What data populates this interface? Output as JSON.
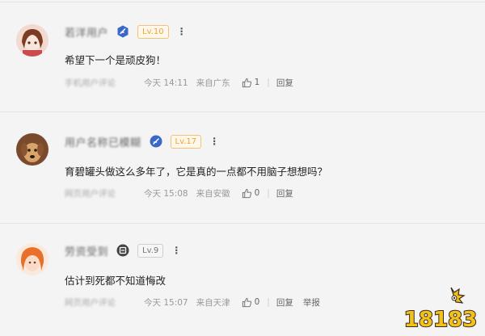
{
  "comments": [
    {
      "username": "若洋用户",
      "level": "Lv.10",
      "level_color": "#f0a533",
      "text": "希望下一个是顽皮狗！",
      "source": "手机用户评论",
      "time": "今天 14:11",
      "location": "来自广东",
      "likes": "1",
      "reply": "回复",
      "verify_color": "#3a67c9"
    },
    {
      "username": "用户名称已模糊",
      "level": "Lv.17",
      "level_color": "#f0a533",
      "text": "育碧罐头做这么多年了，它是真的一点都不用脑子想想吗？",
      "source": "网页用户评论",
      "time": "今天 15:08",
      "location": "来自安徽",
      "likes": "0",
      "reply": "回复",
      "verify_color": "#3a67c9"
    },
    {
      "username": "劳资受到",
      "level": "Lv.9",
      "level_color": "#8c8c8c",
      "text": "估计到死都不知道悔改",
      "source": "网页用户评论",
      "time": "今天 15:07",
      "location": "来自天津",
      "likes": "0",
      "reply": "回复",
      "report": "举报",
      "verify_color": "#444444"
    }
  ],
  "logo": {
    "text": "18183",
    "color": "#f2c21a"
  }
}
